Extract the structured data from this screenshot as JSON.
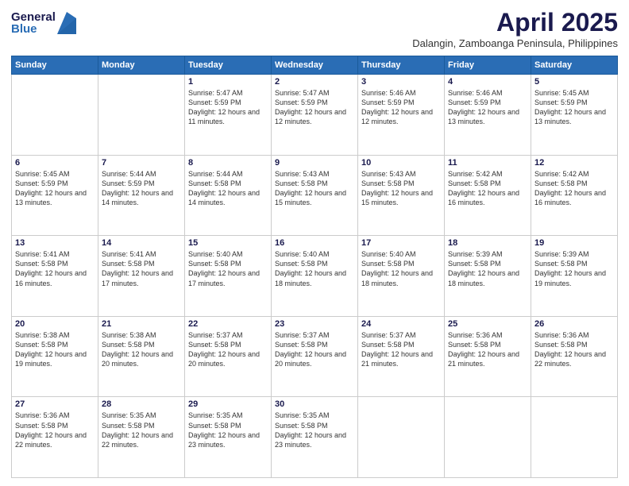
{
  "logo": {
    "general": "General",
    "blue": "Blue"
  },
  "title": "April 2025",
  "location": "Dalangin, Zamboanga Peninsula, Philippines",
  "headers": [
    "Sunday",
    "Monday",
    "Tuesday",
    "Wednesday",
    "Thursday",
    "Friday",
    "Saturday"
  ],
  "weeks": [
    [
      {
        "day": "",
        "info": ""
      },
      {
        "day": "",
        "info": ""
      },
      {
        "day": "1",
        "info": "Sunrise: 5:47 AM\nSunset: 5:59 PM\nDaylight: 12 hours and 11 minutes."
      },
      {
        "day": "2",
        "info": "Sunrise: 5:47 AM\nSunset: 5:59 PM\nDaylight: 12 hours and 12 minutes."
      },
      {
        "day": "3",
        "info": "Sunrise: 5:46 AM\nSunset: 5:59 PM\nDaylight: 12 hours and 12 minutes."
      },
      {
        "day": "4",
        "info": "Sunrise: 5:46 AM\nSunset: 5:59 PM\nDaylight: 12 hours and 13 minutes."
      },
      {
        "day": "5",
        "info": "Sunrise: 5:45 AM\nSunset: 5:59 PM\nDaylight: 12 hours and 13 minutes."
      }
    ],
    [
      {
        "day": "6",
        "info": "Sunrise: 5:45 AM\nSunset: 5:59 PM\nDaylight: 12 hours and 13 minutes."
      },
      {
        "day": "7",
        "info": "Sunrise: 5:44 AM\nSunset: 5:59 PM\nDaylight: 12 hours and 14 minutes."
      },
      {
        "day": "8",
        "info": "Sunrise: 5:44 AM\nSunset: 5:58 PM\nDaylight: 12 hours and 14 minutes."
      },
      {
        "day": "9",
        "info": "Sunrise: 5:43 AM\nSunset: 5:58 PM\nDaylight: 12 hours and 15 minutes."
      },
      {
        "day": "10",
        "info": "Sunrise: 5:43 AM\nSunset: 5:58 PM\nDaylight: 12 hours and 15 minutes."
      },
      {
        "day": "11",
        "info": "Sunrise: 5:42 AM\nSunset: 5:58 PM\nDaylight: 12 hours and 16 minutes."
      },
      {
        "day": "12",
        "info": "Sunrise: 5:42 AM\nSunset: 5:58 PM\nDaylight: 12 hours and 16 minutes."
      }
    ],
    [
      {
        "day": "13",
        "info": "Sunrise: 5:41 AM\nSunset: 5:58 PM\nDaylight: 12 hours and 16 minutes."
      },
      {
        "day": "14",
        "info": "Sunrise: 5:41 AM\nSunset: 5:58 PM\nDaylight: 12 hours and 17 minutes."
      },
      {
        "day": "15",
        "info": "Sunrise: 5:40 AM\nSunset: 5:58 PM\nDaylight: 12 hours and 17 minutes."
      },
      {
        "day": "16",
        "info": "Sunrise: 5:40 AM\nSunset: 5:58 PM\nDaylight: 12 hours and 18 minutes."
      },
      {
        "day": "17",
        "info": "Sunrise: 5:40 AM\nSunset: 5:58 PM\nDaylight: 12 hours and 18 minutes."
      },
      {
        "day": "18",
        "info": "Sunrise: 5:39 AM\nSunset: 5:58 PM\nDaylight: 12 hours and 18 minutes."
      },
      {
        "day": "19",
        "info": "Sunrise: 5:39 AM\nSunset: 5:58 PM\nDaylight: 12 hours and 19 minutes."
      }
    ],
    [
      {
        "day": "20",
        "info": "Sunrise: 5:38 AM\nSunset: 5:58 PM\nDaylight: 12 hours and 19 minutes."
      },
      {
        "day": "21",
        "info": "Sunrise: 5:38 AM\nSunset: 5:58 PM\nDaylight: 12 hours and 20 minutes."
      },
      {
        "day": "22",
        "info": "Sunrise: 5:37 AM\nSunset: 5:58 PM\nDaylight: 12 hours and 20 minutes."
      },
      {
        "day": "23",
        "info": "Sunrise: 5:37 AM\nSunset: 5:58 PM\nDaylight: 12 hours and 20 minutes."
      },
      {
        "day": "24",
        "info": "Sunrise: 5:37 AM\nSunset: 5:58 PM\nDaylight: 12 hours and 21 minutes."
      },
      {
        "day": "25",
        "info": "Sunrise: 5:36 AM\nSunset: 5:58 PM\nDaylight: 12 hours and 21 minutes."
      },
      {
        "day": "26",
        "info": "Sunrise: 5:36 AM\nSunset: 5:58 PM\nDaylight: 12 hours and 22 minutes."
      }
    ],
    [
      {
        "day": "27",
        "info": "Sunrise: 5:36 AM\nSunset: 5:58 PM\nDaylight: 12 hours and 22 minutes."
      },
      {
        "day": "28",
        "info": "Sunrise: 5:35 AM\nSunset: 5:58 PM\nDaylight: 12 hours and 22 minutes."
      },
      {
        "day": "29",
        "info": "Sunrise: 5:35 AM\nSunset: 5:58 PM\nDaylight: 12 hours and 23 minutes."
      },
      {
        "day": "30",
        "info": "Sunrise: 5:35 AM\nSunset: 5:58 PM\nDaylight: 12 hours and 23 minutes."
      },
      {
        "day": "",
        "info": ""
      },
      {
        "day": "",
        "info": ""
      },
      {
        "day": "",
        "info": ""
      }
    ]
  ]
}
